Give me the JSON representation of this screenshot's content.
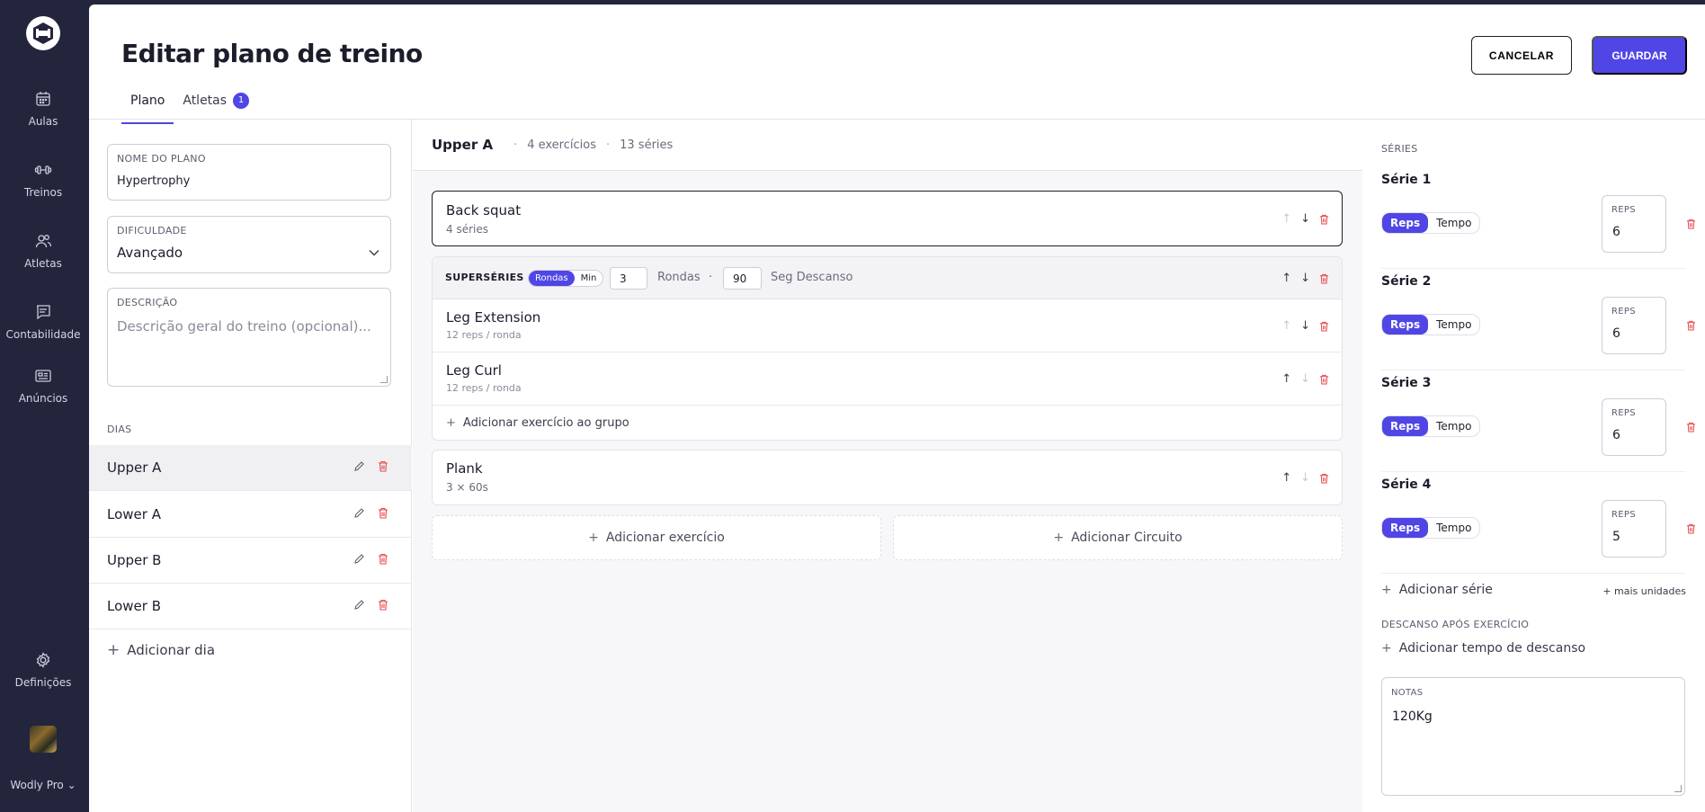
{
  "sidebar": {
    "items": [
      {
        "label": "Aulas",
        "icon": "calendar-icon"
      },
      {
        "label": "Treinos",
        "icon": "dumbbell-icon"
      },
      {
        "label": "Atletas",
        "icon": "users-icon"
      },
      {
        "label": "Contabilidade",
        "icon": "message-icon"
      },
      {
        "label": "Anúncios",
        "icon": "newspaper-icon"
      }
    ],
    "settings_label": "Definições",
    "brand": "Wodly Pro"
  },
  "header": {
    "title": "Editar plano de treino",
    "cancel_label": "CANCELAR",
    "save_label": "GUARDAR",
    "tabs": [
      {
        "label": "Plano"
      },
      {
        "label": "Atletas",
        "count": "1"
      }
    ]
  },
  "plan": {
    "name_label": "NOME DO PLANO",
    "name_value": "Hypertrophy",
    "difficulty_label": "DIFICULDADE",
    "difficulty_value": "Avançado",
    "description_label": "DESCRIÇÃO",
    "description_placeholder": "Descrição geral do treino (opcional)...",
    "days_label": "DIAS",
    "days": [
      "Upper A",
      "Lower A",
      "Upper B",
      "Lower B"
    ],
    "add_day_label": "Adicionar dia"
  },
  "day": {
    "name": "Upper A",
    "exercise_count": "4 exercícios",
    "series_count": "13 séries",
    "exercises": [
      {
        "name": "Back squat",
        "sub": "4 séries"
      }
    ],
    "superset": {
      "title": "SUPERSÉRIES",
      "mode_on": "Rondas",
      "mode_off": "Min",
      "rounds": "3",
      "rounds_label": "Rondas",
      "rest": "90",
      "rest_label": "Seg Descanso",
      "items": [
        {
          "name": "Leg Extension",
          "sub": "12 reps / ronda"
        },
        {
          "name": "Leg Curl",
          "sub": "12 reps / ronda"
        }
      ],
      "add_label": "Adicionar exercício ao grupo"
    },
    "plank": {
      "name": "Plank",
      "sub": "3 × 60s"
    },
    "add_exercise_label": "Adicionar exercício",
    "add_circuit_label": "Adicionar Circuito"
  },
  "series_panel": {
    "label": "SÉRIES",
    "series": [
      {
        "title": "Série 1",
        "reps": "6"
      },
      {
        "title": "Série 2",
        "reps": "6"
      },
      {
        "title": "Série 3",
        "reps": "6"
      },
      {
        "title": "Série 4",
        "reps": "5"
      }
    ],
    "toggle_on": "Reps",
    "toggle_off": "Tempo",
    "reps_label": "REPS",
    "add_series_label": "Adicionar série",
    "more_units_label": "+ mais unidades",
    "rest_label": "DESCANSO APÓS EXERCÍCIO",
    "add_rest_label": "Adicionar tempo de descanso",
    "notes_label": "NOTAS",
    "notes_value": "120Kg"
  },
  "colors": {
    "accent": "#4f46e5",
    "sidebar": "#23253d",
    "danger": "#e5484d"
  }
}
